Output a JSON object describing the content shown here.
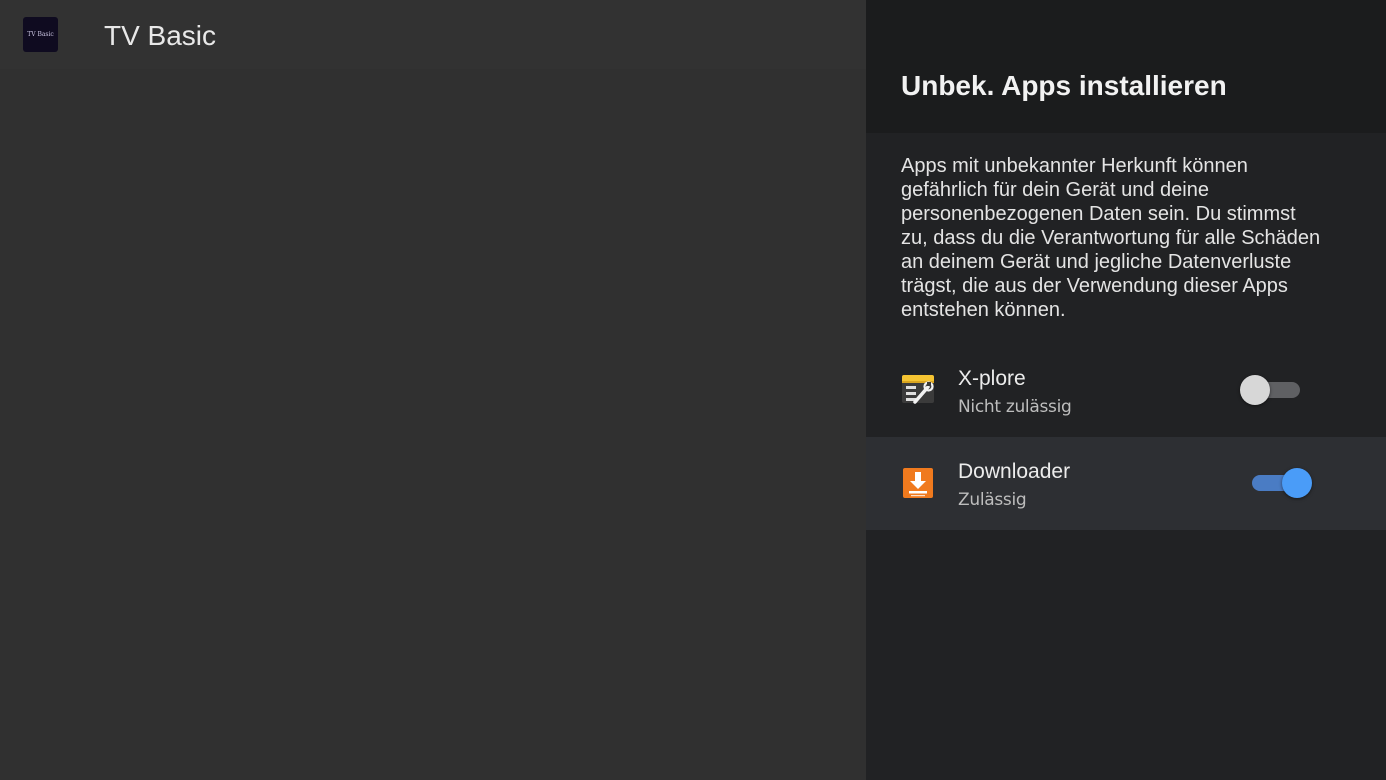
{
  "background_app": {
    "icon_text": "TV Basic",
    "title": "TV Basic"
  },
  "panel": {
    "title": "Unbek. Apps installieren",
    "description": "Apps mit unbekannter Herkunft können gefährlich für dein Gerät und deine personenbezogenen Daten sein. Du stimmst zu, dass du die Verantwortung für alle Schäden an deinem Gerät und jegliche Datenverluste trägst, die aus der Verwendung dieser Apps entstehen können.",
    "apps": [
      {
        "name": "X-plore",
        "status": "Nicht zulässig",
        "icon": "xplore-app-icon",
        "allowed": false
      },
      {
        "name": "Downloader",
        "status": "Zulässig",
        "icon": "downloader-app-icon",
        "allowed": true
      }
    ]
  },
  "colors": {
    "panel_background": "#212224",
    "toggle_on": "#4a9cf8",
    "toggle_off": "#d7d7d7",
    "downloader_brand": "#f07a1e"
  }
}
